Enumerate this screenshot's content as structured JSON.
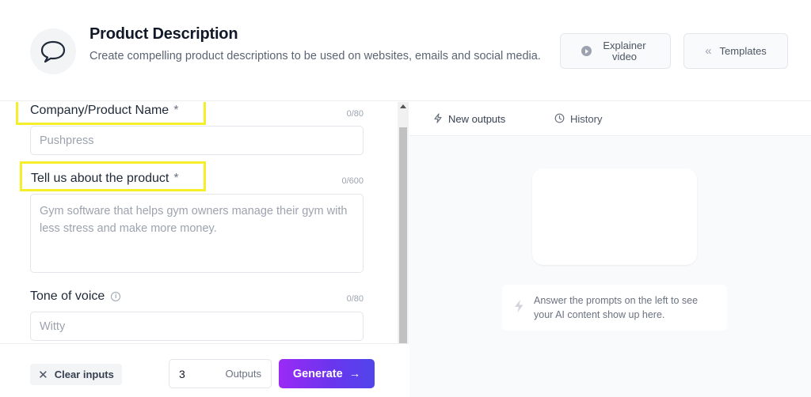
{
  "header": {
    "title": "Product Description",
    "subtitle": "Create compelling product descriptions to be used on websites, emails and social media.",
    "explainer_label": "Explainer video",
    "templates_label": "Templates"
  },
  "form": {
    "company": {
      "label": "Company/Product Name",
      "required_mark": "*",
      "counter": "0/80",
      "placeholder": "Pushpress"
    },
    "product": {
      "label": "Tell us about the product",
      "required_mark": "*",
      "counter": "0/600",
      "placeholder": "Gym software that helps gym owners manage their gym with less stress and make more money."
    },
    "tone": {
      "label": "Tone of voice",
      "counter": "0/80",
      "placeholder": "Witty"
    }
  },
  "footer": {
    "clear_label": "Clear inputs",
    "outputs_count": "3",
    "outputs_unit": "Outputs",
    "generate_label": "Generate"
  },
  "output_panel": {
    "tabs": [
      {
        "label": "New outputs",
        "icon": "lightning-icon",
        "active": true
      },
      {
        "label": "History",
        "icon": "clock-icon",
        "active": false
      }
    ],
    "hint": "Answer the prompts on the left to see your AI content show up here."
  },
  "colors": {
    "highlight": "#f5ee2a",
    "generate_gradient_start": "#9b2af5",
    "generate_gradient_end": "#5145ea"
  }
}
